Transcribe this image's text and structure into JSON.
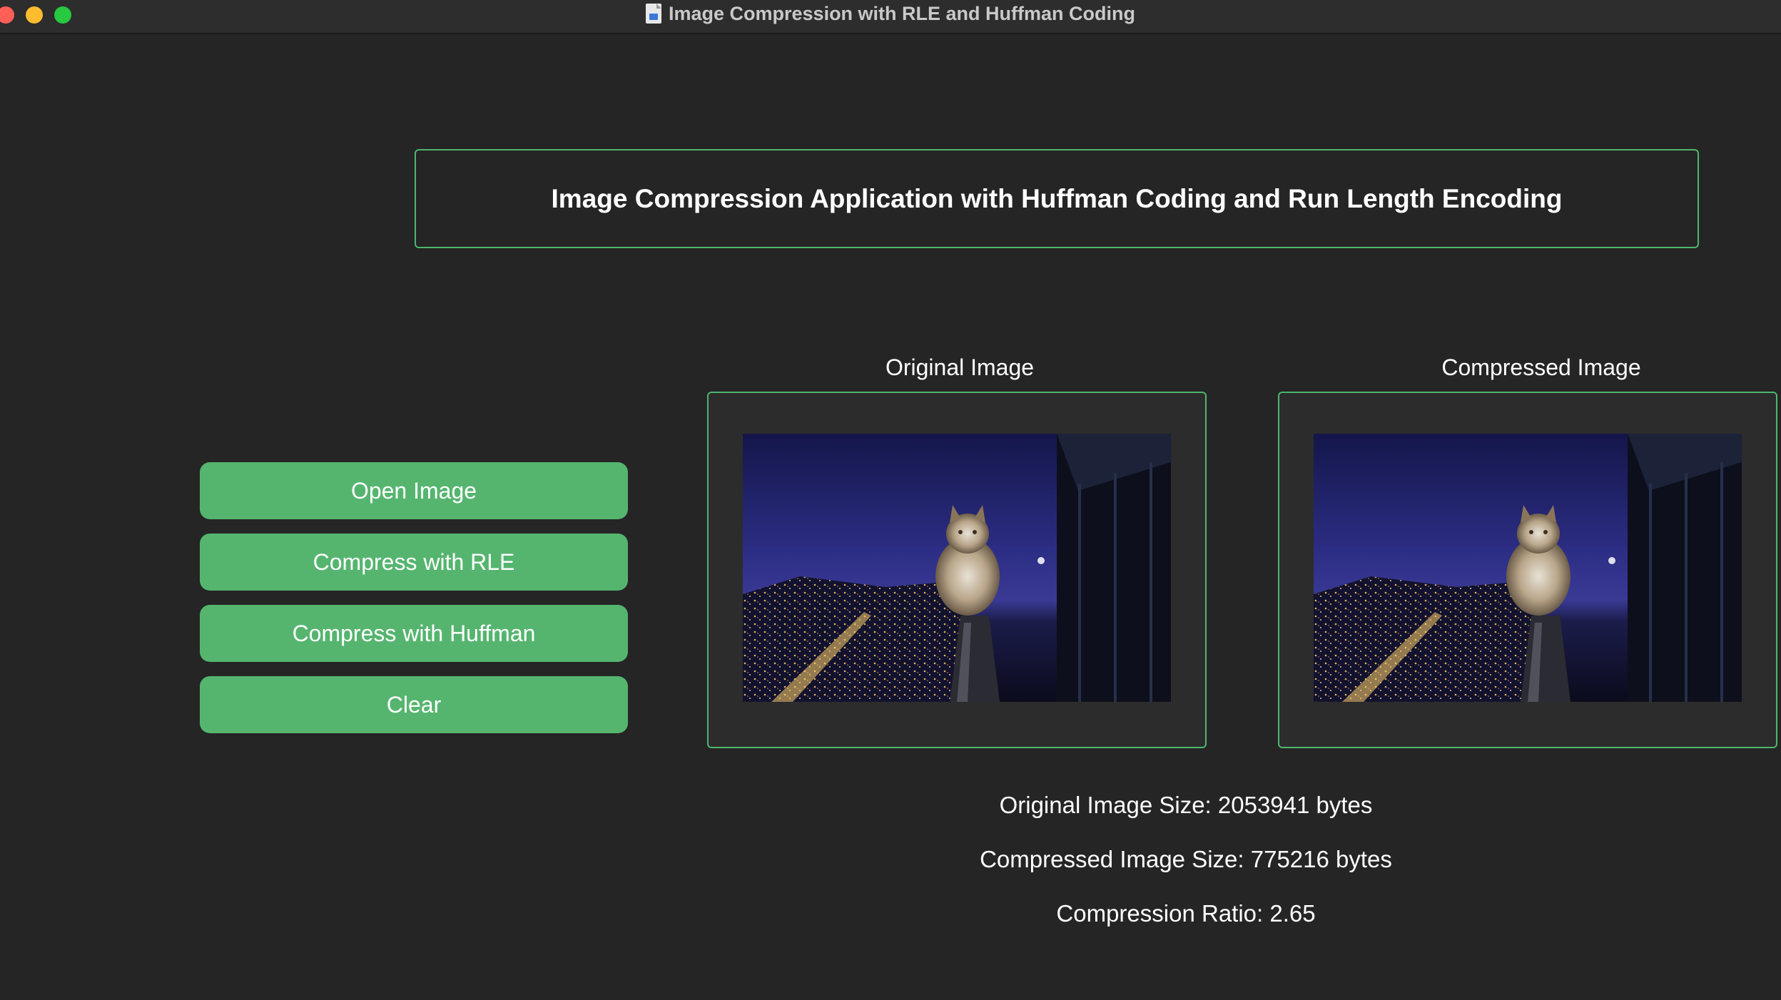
{
  "window": {
    "title": "Image Compression with RLE and Huffman Coding",
    "title_icon": "document-icon"
  },
  "header": {
    "title": "Image Compression Application with Huffman Coding and Run Length Encoding"
  },
  "buttons": {
    "open": "Open Image",
    "compress_rle": "Compress with RLE",
    "compress_huffman": "Compress with Huffman",
    "clear": "Clear"
  },
  "panels": {
    "original_label": "Original Image",
    "compressed_label": "Compressed Image"
  },
  "stats": {
    "original_size": "Original Image Size: 2053941 bytes",
    "compressed_size": "Compressed Image Size: 775216 bytes",
    "ratio": "Compression Ratio: 2.65"
  },
  "colors": {
    "background": "#252525",
    "accent": "#55b56f",
    "border": "#4fb56e"
  }
}
